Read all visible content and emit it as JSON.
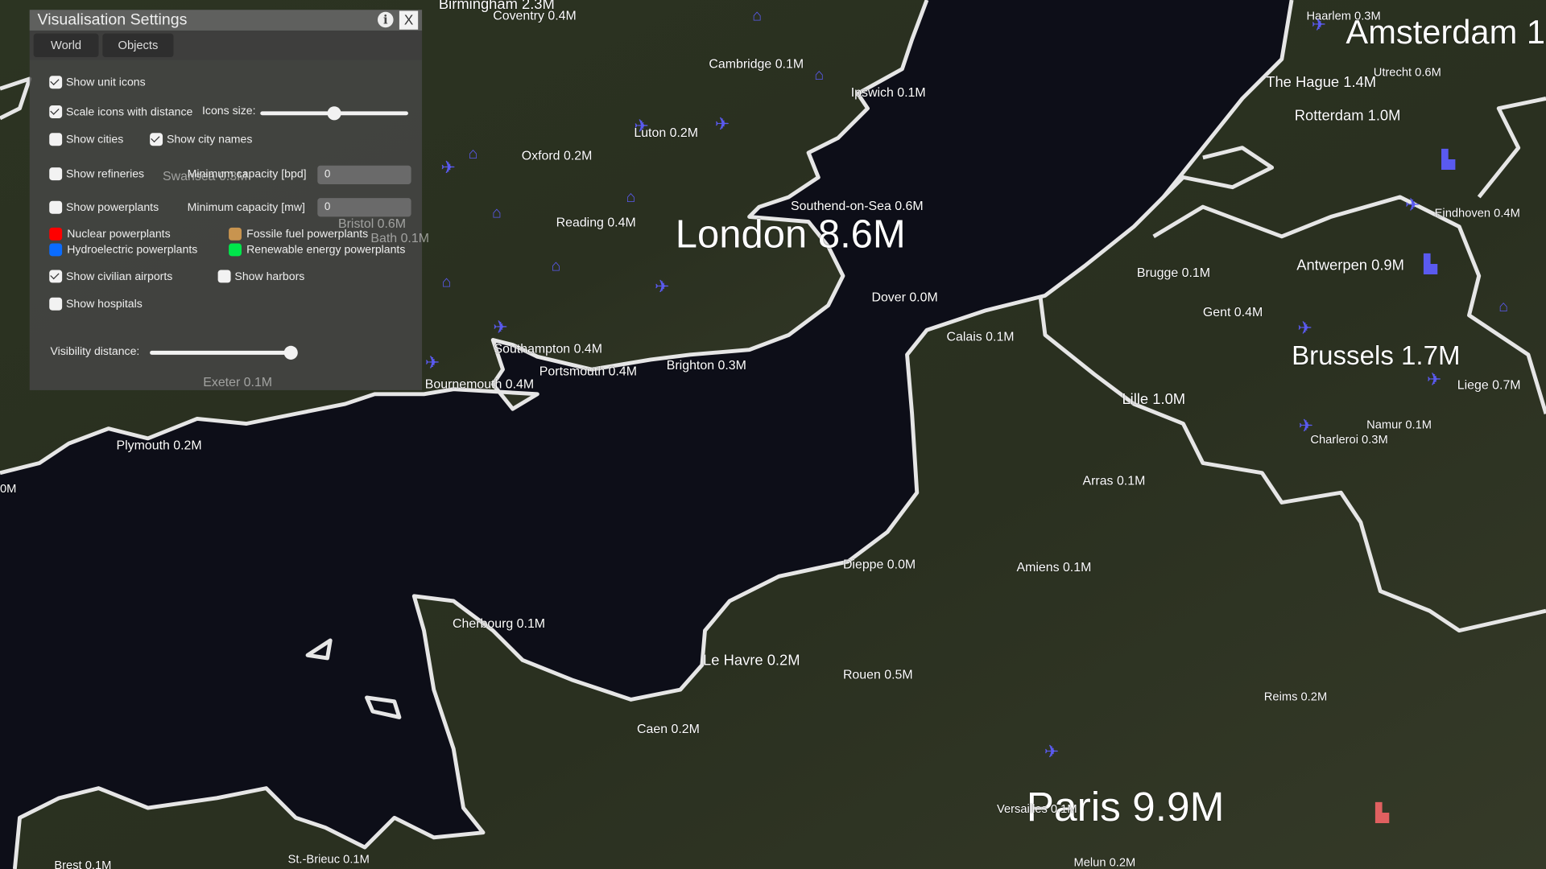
{
  "colors": {
    "sea": "#0d0e18",
    "land": "#2a3120",
    "coast": "#e6e6e6",
    "icon": "#5a5af0",
    "nuclear": "#ff0000",
    "hydro": "#0a6cff",
    "fossil": "#c8944f",
    "renewable": "#00e64b"
  },
  "panel": {
    "title": "Visualisation Settings",
    "info_icon": "i",
    "close_icon": "X",
    "tabs": [
      "World",
      "Objects"
    ],
    "show_unit_icons": {
      "label": "Show unit icons",
      "checked": true
    },
    "scale_icons": {
      "label": "Scale icons with distance",
      "checked": true
    },
    "icons_size": {
      "label": "Icons size:",
      "value": 0.5
    },
    "show_cities": {
      "label": "Show cities",
      "checked": false
    },
    "show_city_names": {
      "label": "Show city names",
      "checked": true
    },
    "show_refineries": {
      "label": "Show refineries",
      "checked": false
    },
    "refinery_min_capacity": {
      "label": "Minimum capacity [bpd]",
      "value": "0"
    },
    "show_powerplants": {
      "label": "Show powerplants",
      "checked": false
    },
    "powerplant_min_capacity": {
      "label": "Minimum capacity [mw]",
      "value": "0"
    },
    "legend": {
      "nuclear": "Nuclear powerplants",
      "fossil": "Fossile fuel powerplants",
      "hydro": "Hydroelectric powerplants",
      "renewable": "Renewable energy powerplants"
    },
    "show_airports": {
      "label": "Show civilian airports",
      "checked": true
    },
    "show_harbors": {
      "label": "Show harbors",
      "checked": false
    },
    "show_hospitals": {
      "label": "Show hospitals",
      "checked": false
    },
    "visibility_distance": {
      "label": "Visibility distance:",
      "value": 1.0
    }
  },
  "cities": [
    "Birmingham 2.3M",
    "Coventry 0.4M",
    "Cambridge 0.1M",
    "Ipswich 0.1M",
    "Luton 0.2M",
    "Oxford 0.2M",
    "Reading 0.4M",
    "Southend-on-Sea 0.6M",
    "London 8.6M",
    "Dover 0.0M",
    "Southampton 0.4M",
    "Portsmouth 0.4M",
    "Brighton 0.3M",
    "Bournemouth 0.4M",
    "Exeter 0.1M",
    "Bristol 0.6M",
    "Bath 0.1M",
    "Swansea 0.3M",
    "Plymouth 0.2M",
    "0M",
    "Cherbourg 0.1M",
    "Le Havre 0.2M",
    "Rouen 0.5M",
    "Caen 0.2M",
    "Dieppe 0.0M",
    "Amiens 0.1M",
    "Arras 0.1M",
    "Calais 0.1M",
    "Lille 1.0M",
    "Brugge 0.1M",
    "Gent 0.4M",
    "Antwerpen 0.9M",
    "Brussels 1.7M",
    "Liege 0.7M",
    "Namur 0.1M",
    "Charleroi 0.3M",
    "Eindhoven 0.4M",
    "Rotterdam 1.0M",
    "The Hague 1.4M",
    "Utrecht 0.6M",
    "Haarlem 0.3M",
    "Amsterdam 1",
    "Reims 0.2M",
    "Paris 9.9M",
    "Versailles 0.1M",
    "Melun 0.2M",
    "St.-Brieuc 0.1M",
    "Brest 0.1M"
  ]
}
